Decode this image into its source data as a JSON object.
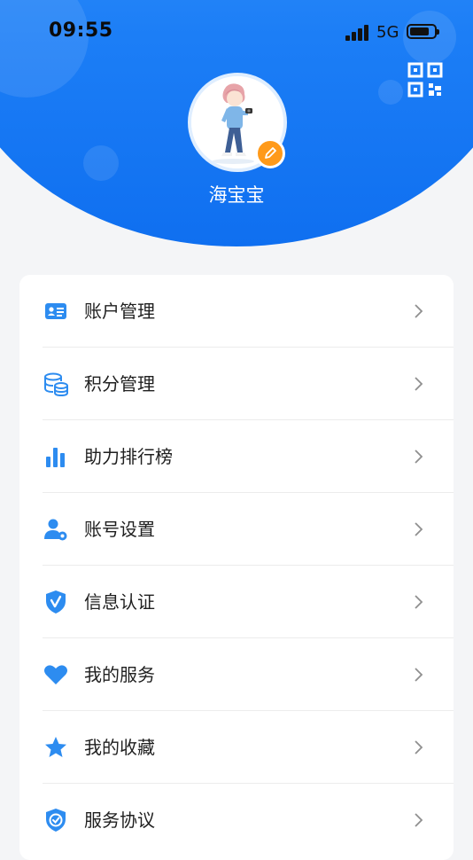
{
  "status_bar": {
    "time": "09:55",
    "network": "5G",
    "battery_level": 0.8
  },
  "profile": {
    "username": "海宝宝",
    "avatar_icon": "avatar-photographer-illustration",
    "edit_icon": "pencil-icon",
    "qr_icon": "qr-code-icon"
  },
  "menu": {
    "items": [
      {
        "label": "账户管理",
        "icon": "id-card-icon"
      },
      {
        "label": "积分管理",
        "icon": "database-coins-icon"
      },
      {
        "label": "助力排行榜",
        "icon": "bar-chart-icon"
      },
      {
        "label": "账号设置",
        "icon": "user-settings-icon"
      },
      {
        "label": "信息认证",
        "icon": "shield-check-icon"
      },
      {
        "label": "我的服务",
        "icon": "heart-icon"
      },
      {
        "label": "我的收藏",
        "icon": "star-icon"
      },
      {
        "label": "服务协议",
        "icon": "shield-check-icon"
      }
    ]
  },
  "colors": {
    "accent": "#1c7ef6",
    "edit_badge": "#ff9a1a",
    "page_bg": "#f4f5f7"
  }
}
